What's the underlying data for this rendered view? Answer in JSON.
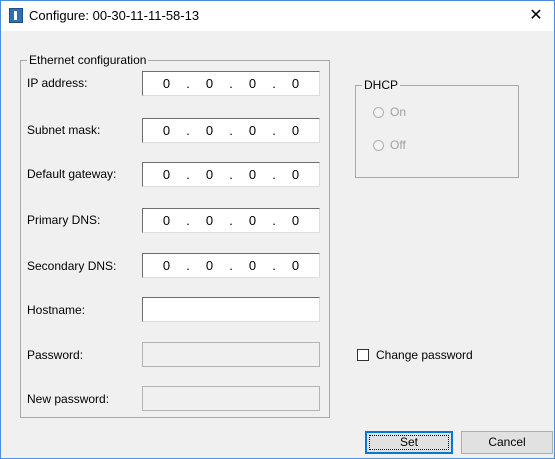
{
  "window": {
    "title": "Configure: 00-30-11-11-58-13",
    "close_glyph": "✕",
    "icon": "app-icon",
    "accent_color": "#4a90d9"
  },
  "ethernet": {
    "group_title": "Ethernet configuration",
    "ip_address": {
      "label": "IP address:",
      "octets": [
        "0",
        "0",
        "0",
        "0"
      ]
    },
    "subnet_mask": {
      "label": "Subnet mask:",
      "octets": [
        "0",
        "0",
        "0",
        "0"
      ]
    },
    "default_gateway": {
      "label": "Default gateway:",
      "octets": [
        "0",
        "0",
        "0",
        "0"
      ]
    },
    "primary_dns": {
      "label": "Primary DNS:",
      "octets": [
        "0",
        "0",
        "0",
        "0"
      ]
    },
    "secondary_dns": {
      "label": "Secondary DNS:",
      "octets": [
        "0",
        "0",
        "0",
        "0"
      ]
    },
    "hostname": {
      "label": "Hostname:",
      "value": ""
    },
    "password": {
      "label": "Password:",
      "value": ""
    },
    "new_password": {
      "label": "New password:",
      "value": ""
    },
    "ip_separator": "."
  },
  "dhcp": {
    "group_title": "DHCP",
    "on_label": "On",
    "off_label": "Off"
  },
  "change_password": {
    "label": "Change password"
  },
  "buttons": {
    "set_label": "Set",
    "cancel_label": "Cancel"
  }
}
